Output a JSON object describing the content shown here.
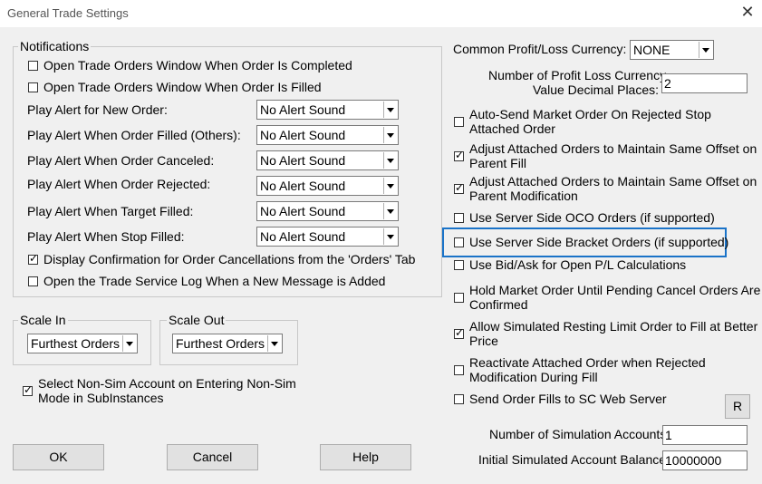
{
  "window": {
    "title": "General Trade Settings"
  },
  "notifications": {
    "legend": "Notifications",
    "open_on_completed": {
      "label": "Open Trade Orders Window When Order Is Completed",
      "checked": false
    },
    "open_on_filled": {
      "label": "Open Trade Orders Window When Order Is Filled",
      "checked": false
    },
    "alerts": [
      {
        "label": "Play Alert for New Order:",
        "value": "No Alert Sound"
      },
      {
        "label": "Play Alert When Order Filled (Others):",
        "value": "No Alert Sound"
      },
      {
        "label": "Play Alert When Order Canceled:",
        "value": "No Alert Sound"
      },
      {
        "label": "Play Alert When Order Rejected:",
        "value": "No Alert Sound"
      },
      {
        "label": "Play Alert When Target Filled:",
        "value": "No Alert Sound"
      },
      {
        "label": "Play Alert When Stop Filled:",
        "value": "No Alert Sound"
      }
    ],
    "display_confirmation": {
      "label": "Display Confirmation for Order Cancellations from the 'Orders' Tab",
      "checked": true
    },
    "open_log": {
      "label": "Open the Trade Service Log When a New Message is Added",
      "checked": false
    }
  },
  "scale_in": {
    "legend": "Scale In",
    "value": "Furthest Orders"
  },
  "scale_out": {
    "legend": "Scale Out",
    "value": "Furthest Orders"
  },
  "select_non_sim": {
    "line1": "Select Non-Sim Account on Entering Non-Sim",
    "line2": "Mode in SubInstances",
    "checked": true
  },
  "buttons": {
    "ok": "OK",
    "cancel": "Cancel",
    "help": "Help",
    "r": "R"
  },
  "right": {
    "currency_label": "Common Profit/Loss Currency:",
    "currency_value": "NONE",
    "decimal_line1": "Number of Profit Loss Currency",
    "decimal_line2": "Value Decimal Places:",
    "decimal_value": "2",
    "options": [
      {
        "line1": "Auto-Send Market Order On Rejected Stop",
        "line2": "Attached Order",
        "checked": false
      },
      {
        "line1": "Adjust Attached Orders to Maintain Same Offset on",
        "line2": "Parent Fill",
        "checked": true
      },
      {
        "line1": "Adjust Attached Orders to Maintain Same Offset on",
        "line2": "Parent Modification",
        "checked": true
      },
      {
        "line1": "Use Server Side OCO Orders (if supported)",
        "line2": "",
        "checked": false
      },
      {
        "line1": "Use Server Side Bracket Orders (if supported)",
        "line2": "",
        "checked": false
      },
      {
        "line1": "Use Bid/Ask for Open P/L Calculations",
        "line2": "",
        "checked": false
      },
      {
        "line1": "Hold Market Order Until Pending Cancel Orders Are",
        "line2": "Confirmed",
        "checked": false
      },
      {
        "line1": "Allow Simulated Resting Limit Order to Fill at Better",
        "line2": "Price",
        "checked": true
      },
      {
        "line1": "Reactivate Attached Order when Rejected",
        "line2": "Modification During Fill",
        "checked": false
      },
      {
        "line1": "Send Order Fills to SC Web Server",
        "line2": "",
        "checked": false
      }
    ],
    "sim_accounts_label": "Number of Simulation Accounts:",
    "sim_accounts_value": "1",
    "initial_balance_label": "Initial Simulated Account Balance:",
    "initial_balance_value": "10000000"
  },
  "colors": {
    "highlight": "#1a73c8"
  }
}
